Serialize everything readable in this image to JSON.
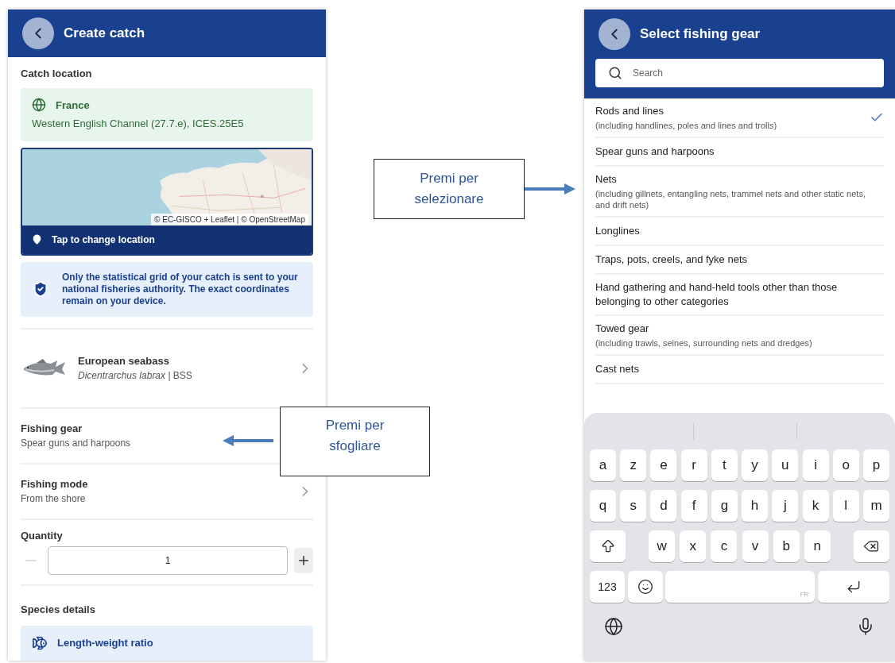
{
  "create_catch": {
    "title": "Create catch",
    "section_location": "Catch location",
    "location": {
      "country": "France",
      "area": "Western English Channel (27.7.e), ICES.25E5"
    },
    "map": {
      "kind": "picture",
      "attribution": "© EC-GISCO + Leaflet | © OpenStreetMap",
      "action": "Tap to change location"
    },
    "privacy_note": "Only the statistical grid of your catch is sent to your national fisheries authority. The exact coordinates remain on your device.",
    "species": {
      "name": "European seabass",
      "scientific": "*Dicentrarchus labrax* | BSS"
    },
    "fields": [
      {
        "label": "Fishing gear",
        "value": "Spear guns and harpoons",
        "chevron": false
      },
      {
        "label": "Fishing mode",
        "value": "From the shore",
        "chevron": true
      }
    ],
    "quantity": {
      "label": "Quantity",
      "value": "1",
      "minus_disabled": true
    },
    "section_species": "Species details",
    "ratio_card": {
      "title": "Length-weight ratio"
    }
  },
  "select_gear": {
    "title": "Select fishing gear",
    "search": {
      "placeholder": "Search"
    },
    "items": [
      {
        "name": "Rods and lines",
        "detail": "(including handlines, poles and lines and trolls)",
        "selected": true
      },
      {
        "name": "Spear guns and harpoons",
        "selected": false
      },
      {
        "name": "Nets",
        "detail": "(including gillnets, entangling nets, trammel nets and other static nets, and drift nets)",
        "selected": false
      },
      {
        "name": "Longlines",
        "selected": false
      },
      {
        "name": "Traps, pots, creels, and fyke nets",
        "selected": false
      },
      {
        "name": "Hand gathering and hand-held tools other than those belonging to other categories",
        "selected": false
      },
      {
        "name": "Towed gear",
        "detail": "(including trawls, seines, surrounding nets and dredges)",
        "selected": false
      },
      {
        "name": "Cast nets",
        "selected": false
      }
    ],
    "keyboard": {
      "rows": [
        [
          {
            "kind": "letter",
            "label": "a"
          },
          {
            "kind": "letter",
            "label": "z"
          },
          {
            "kind": "letter",
            "label": "e"
          },
          {
            "kind": "letter",
            "label": "r"
          },
          {
            "kind": "letter",
            "label": "t"
          },
          {
            "kind": "letter",
            "label": "y"
          },
          {
            "kind": "letter",
            "label": "u"
          },
          {
            "kind": "letter",
            "label": "i"
          },
          {
            "kind": "letter",
            "label": "o"
          },
          {
            "kind": "letter",
            "label": "p"
          }
        ],
        [
          {
            "kind": "letter",
            "label": "q"
          },
          {
            "kind": "letter",
            "label": "s"
          },
          {
            "kind": "letter",
            "label": "d"
          },
          {
            "kind": "letter",
            "label": "f"
          },
          {
            "kind": "letter",
            "label": "g"
          },
          {
            "kind": "letter",
            "label": "h"
          },
          {
            "kind": "letter",
            "label": "j"
          },
          {
            "kind": "letter",
            "label": "k"
          },
          {
            "kind": "letter",
            "label": "l"
          },
          {
            "kind": "letter",
            "label": "m"
          }
        ],
        [
          {
            "kind": "shift"
          },
          {
            "kind": "gap"
          },
          {
            "kind": "letter",
            "label": "w"
          },
          {
            "kind": "letter",
            "label": "x"
          },
          {
            "kind": "letter",
            "label": "c"
          },
          {
            "kind": "letter",
            "label": "v"
          },
          {
            "kind": "letter",
            "label": "b"
          },
          {
            "kind": "letter",
            "label": "n"
          },
          {
            "kind": "gap"
          },
          {
            "kind": "backspace"
          }
        ],
        [
          {
            "kind": "numbers",
            "label": "123"
          },
          {
            "kind": "emoji"
          },
          {
            "kind": "space",
            "label": "FR"
          },
          {
            "kind": "return"
          }
        ]
      ]
    }
  },
  "callouts": [
    {
      "text": "Premi per selezionare"
    },
    {
      "text": "Premi per sfogliare"
    }
  ]
}
